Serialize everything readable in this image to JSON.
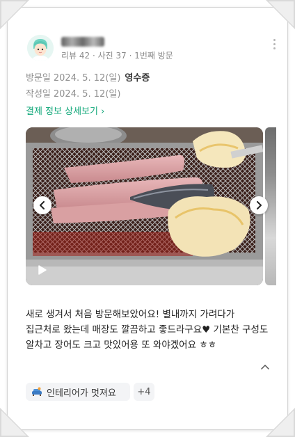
{
  "author": {
    "stats": "리뷰 42 · 사진 37 · 1번째 방문"
  },
  "visit": {
    "visit_label": "방문일",
    "visit_date": "2024. 5. 12(일)",
    "receipt_label": "영수증",
    "written_label": "작성일",
    "written_date": "2024. 5. 12(일)"
  },
  "payment_link": "결제 정보 상세보기 ›",
  "review": {
    "text": "새로 생겨서 처음 방문해보았어요! 별내까지 가려다가 집근처로 왔는데 매장도 깔끔하고 좋드라구요♥ 기본찬 구성도 알차고 장어도 크고 맛있어용 또 와야겠어요 ㅎㅎ"
  },
  "tags": {
    "interior": "인테리어가 멋져요",
    "more_count": "+4"
  },
  "icons": {
    "menu": "kebab-menu-icon",
    "prev": "chevron-left-icon",
    "next": "chevron-right-icon",
    "video": "play-icon",
    "collapse": "chevron-up-icon",
    "tag": "sofa-icon"
  },
  "colors": {
    "link": "#12a87a"
  }
}
